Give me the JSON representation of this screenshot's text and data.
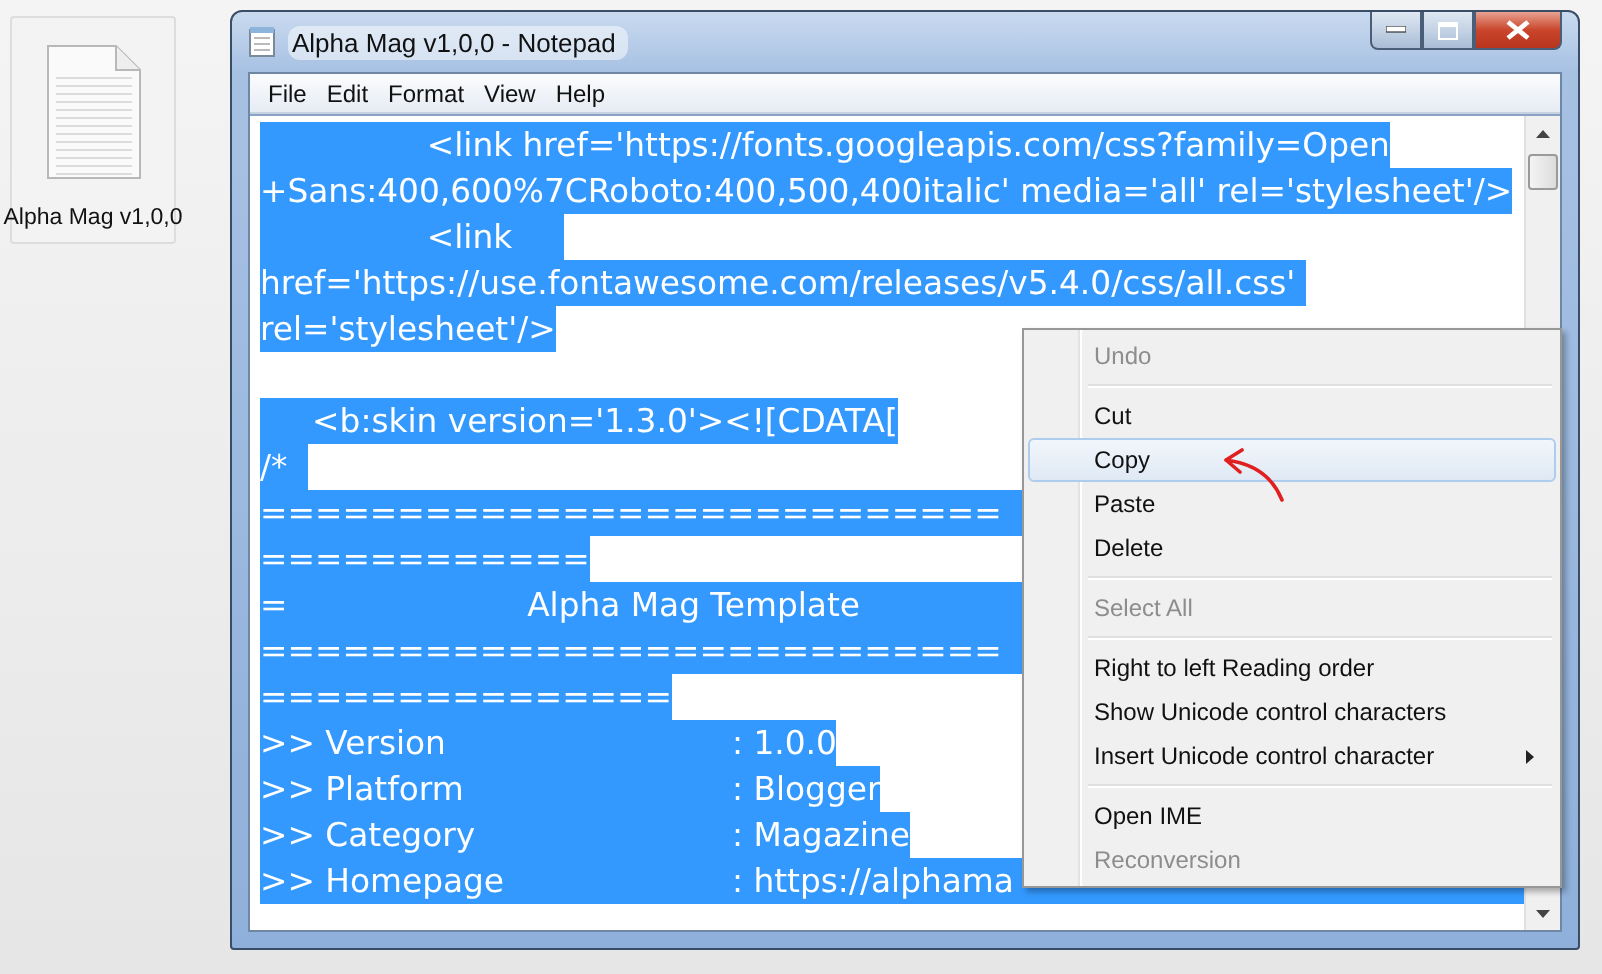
{
  "desktop_icon": {
    "label": "Alpha Mag v1,0,0"
  },
  "window": {
    "title": "Alpha Mag v1,0,0 - Notepad"
  },
  "menu_bar": [
    "File",
    "Edit",
    "Format",
    "View",
    "Help"
  ],
  "editor": {
    "lines": [
      {
        "kind": "text",
        "text": "                <link href='https://fonts.googleapis.com/css?family=Open",
        "selected": true
      },
      {
        "kind": "text",
        "text": "+Sans:400,600%7CRoboto:400,500,400italic' media='all' rel='stylesheet'/>",
        "selected": true
      },
      {
        "kind": "text",
        "text": "                <link     ",
        "selected": true
      },
      {
        "kind": "text",
        "text": "href='https://use.fontawesome.com/releases/v5.4.0/css/all.css' ",
        "selected": true
      },
      {
        "kind": "text",
        "text": "rel='stylesheet'/>",
        "selected": true
      },
      {
        "kind": "blank"
      },
      {
        "kind": "text",
        "text": "     <b:skin version='1.3.0'><![CDATA[",
        "selected": true
      },
      {
        "kind": "text",
        "text": "/*  ",
        "selected": true
      },
      {
        "kind": "text",
        "text": "===========================",
        "selected": true,
        "continues": true
      },
      {
        "kind": "text",
        "text": "============",
        "selected": true
      },
      {
        "kind": "text",
        "text": "=                       Alpha Mag Template",
        "selected": true,
        "continues": true
      },
      {
        "kind": "text",
        "text": "===========================",
        "selected": true,
        "continues": true
      },
      {
        "kind": "text",
        "text": "===============",
        "selected": true
      },
      {
        "kind": "field",
        "label": ">> Version",
        "value": ": 1.0.0",
        "selected": true
      },
      {
        "kind": "field",
        "label": ">> Platform",
        "value": ": Blogger",
        "selected": true
      },
      {
        "kind": "field",
        "label": ">> Category",
        "value": ": Magazine",
        "selected": true
      },
      {
        "kind": "field",
        "label": ">> Homepage",
        "value": ": https://alphama",
        "selected": true,
        "continues": true
      }
    ]
  },
  "context_menu": {
    "items": [
      {
        "kind": "item",
        "label": "Undo",
        "disabled": true,
        "selected": false
      },
      {
        "kind": "separator"
      },
      {
        "kind": "item",
        "label": "Cut",
        "disabled": false,
        "selected": false
      },
      {
        "kind": "item",
        "label": "Copy",
        "disabled": false,
        "selected": true
      },
      {
        "kind": "item",
        "label": "Paste",
        "disabled": false,
        "selected": false
      },
      {
        "kind": "item",
        "label": "Delete",
        "disabled": false,
        "selected": false
      },
      {
        "kind": "separator"
      },
      {
        "kind": "item",
        "label": "Select All",
        "disabled": true,
        "selected": false
      },
      {
        "kind": "separator"
      },
      {
        "kind": "item",
        "label": "Right to left Reading order",
        "disabled": false,
        "selected": false
      },
      {
        "kind": "item",
        "label": "Show Unicode control characters",
        "disabled": false,
        "selected": false
      },
      {
        "kind": "submenu",
        "label": "Insert Unicode control character",
        "disabled": false,
        "selected": false
      },
      {
        "kind": "separator"
      },
      {
        "kind": "item",
        "label": "Open IME",
        "disabled": false,
        "selected": false
      },
      {
        "kind": "item",
        "label": "Reconversion",
        "disabled": true,
        "selected": false
      }
    ]
  }
}
